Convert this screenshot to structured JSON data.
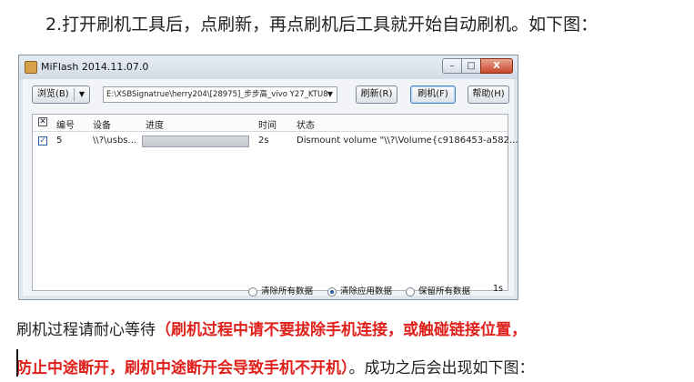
{
  "heading": "2.打开刷机工具后，点刷新，再点刷机后工具就开始自动刷机。如下图：",
  "window": {
    "title": "MiFlash 2014.11.07.0",
    "controls": {
      "minimize": "–",
      "maximize": "□",
      "close": "X"
    },
    "toolbar": {
      "browse_label": "浏览(B)",
      "path_value": "E:\\XSBSignatrue\\herry204\\[28975]_步步高_vivo Y27_KTU8",
      "refresh_label": "刷新(R)",
      "flash_label": "刷机(F)",
      "help_label": "帮助(H)"
    },
    "table": {
      "columns": [
        "编号",
        "设备",
        "进度",
        "时间",
        "状态"
      ],
      "rows": [
        {
          "checked": true,
          "number": "5",
          "device": "\\\\?\\usbs...",
          "progress": 1.0,
          "time": "2s",
          "status": "Dismount volume \"\\\\?\\Volume{c9186453-a582..."
        }
      ]
    },
    "status_bar": {
      "options": [
        {
          "label": "清除所有数据",
          "selected": false
        },
        {
          "label": "清除应用数据",
          "selected": true
        },
        {
          "label": "保留所有数据",
          "selected": false
        }
      ],
      "elapsed": "1s"
    }
  },
  "paragraph": {
    "line1_plain": "刷机过程请耐心等待",
    "line1_red": "（刷机过程中请不要拔除手机连接，或触碰链接位置，",
    "line2_red": "防止中途断开，刷机中途断开会导致手机不开机）",
    "line2_plain": "。成功之后会出现如下图："
  },
  "colors": {
    "warning_red": "#e0201b",
    "title_bar": "#d2dbe6"
  }
}
